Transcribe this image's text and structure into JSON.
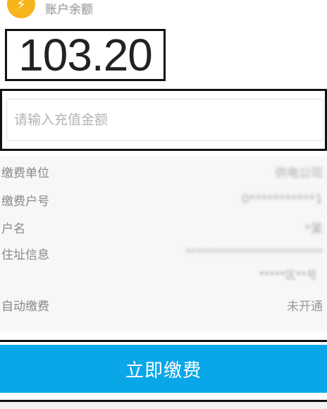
{
  "header": {
    "icon": "lightning-icon",
    "label": "账户余额"
  },
  "balance": {
    "value": "103.20"
  },
  "recharge_input": {
    "value": "",
    "placeholder": "请输入充值金额"
  },
  "info": {
    "rows": [
      {
        "label": "缴费单位",
        "value": "供电公司"
      },
      {
        "label": "缴费户号",
        "value": "0***********1"
      },
      {
        "label": "户名",
        "value": "*某"
      },
      {
        "label": "住址信息",
        "value_line1": "**************************",
        "value_line2": "*****区**号"
      },
      {
        "label": "自动缴费",
        "value": "未开通"
      }
    ]
  },
  "pay_button": {
    "label": "立即缴费"
  },
  "colors": {
    "primary_button": "#0aa7e8",
    "icon_bg": "#f6b51c",
    "info_bg": "#f7f7f7"
  }
}
